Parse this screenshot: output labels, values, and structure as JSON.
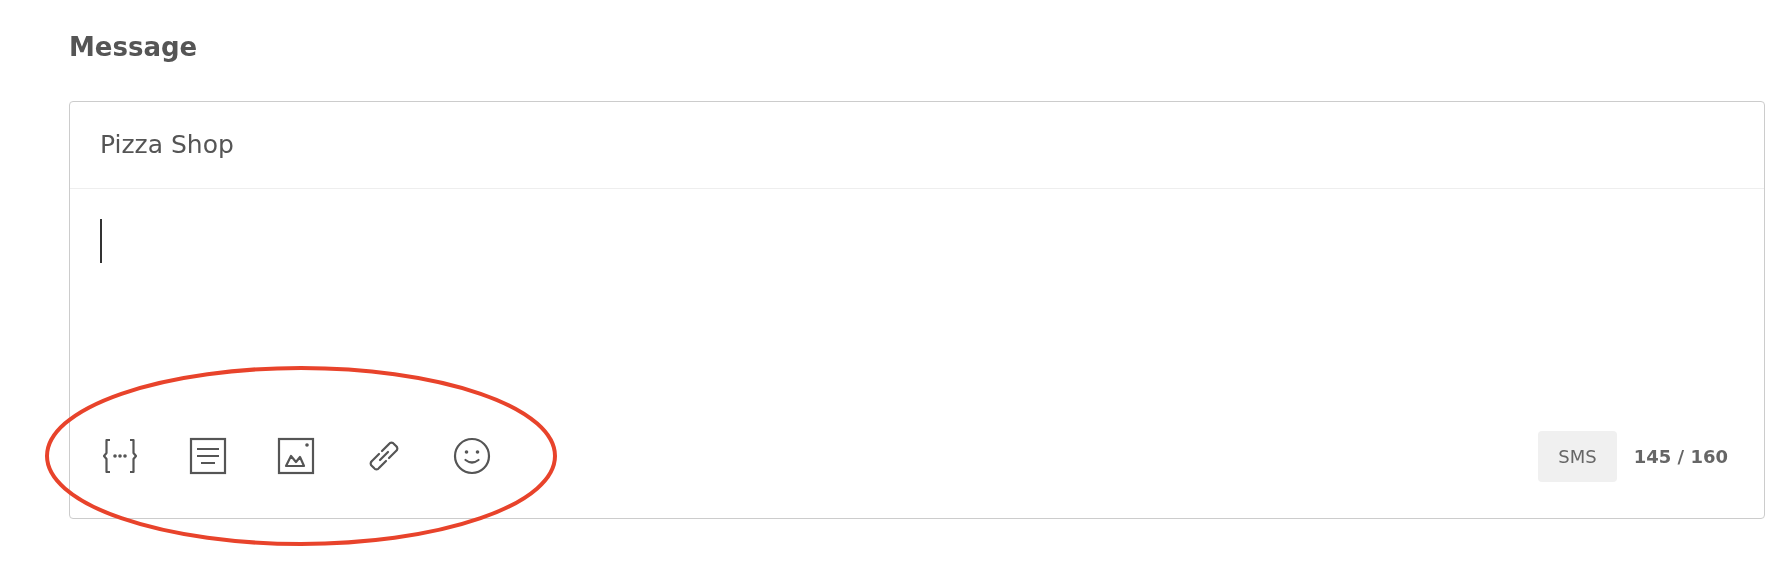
{
  "section_label": "Message",
  "composer": {
    "sender": "Pizza Shop",
    "body_focused": true,
    "toolbar": [
      {
        "kind": "variables"
      },
      {
        "kind": "template"
      },
      {
        "kind": "image"
      },
      {
        "kind": "link"
      },
      {
        "kind": "emoji"
      }
    ],
    "channel": "SMS",
    "char_count": "145 / 160"
  },
  "annotations": [
    {
      "kind": "ellipse"
    }
  ]
}
